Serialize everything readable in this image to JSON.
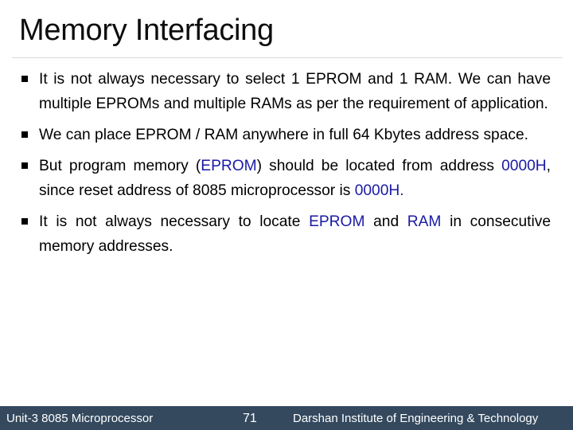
{
  "slide": {
    "title": "Memory Interfacing",
    "accent_color": "#1a1aa6",
    "bullets": [
      {
        "segments": [
          {
            "text": "It is not always necessary to select 1 EPROM and 1 RAM. We can have multiple EPROMs and multiple RAMs as per the requirement of application.",
            "highlight": false
          }
        ]
      },
      {
        "segments": [
          {
            "text": "We can place EPROM / RAM anywhere in full 64 Kbytes address space.",
            "highlight": false
          }
        ]
      },
      {
        "segments": [
          {
            "text": "But program memory (",
            "highlight": false
          },
          {
            "text": "EPROM",
            "highlight": true
          },
          {
            "text": ") should be located from address ",
            "highlight": false
          },
          {
            "text": "0000H",
            "highlight": true
          },
          {
            "text": ", since reset address of 8085 microprocessor is ",
            "highlight": false
          },
          {
            "text": "0000H.",
            "highlight": true
          }
        ]
      },
      {
        "segments": [
          {
            "text": "It is not always necessary to locate ",
            "highlight": false
          },
          {
            "text": "EPROM",
            "highlight": true
          },
          {
            "text": " and ",
            "highlight": false
          },
          {
            "text": "RAM",
            "highlight": true
          },
          {
            "text": " in consecutive memory addresses.",
            "highlight": false
          }
        ]
      }
    ]
  },
  "footer": {
    "unit": "Unit-3 8085 Microprocessor",
    "page_number": "71",
    "institute": "Darshan Institute of Engineering & Technology",
    "background_color": "#34495e"
  }
}
